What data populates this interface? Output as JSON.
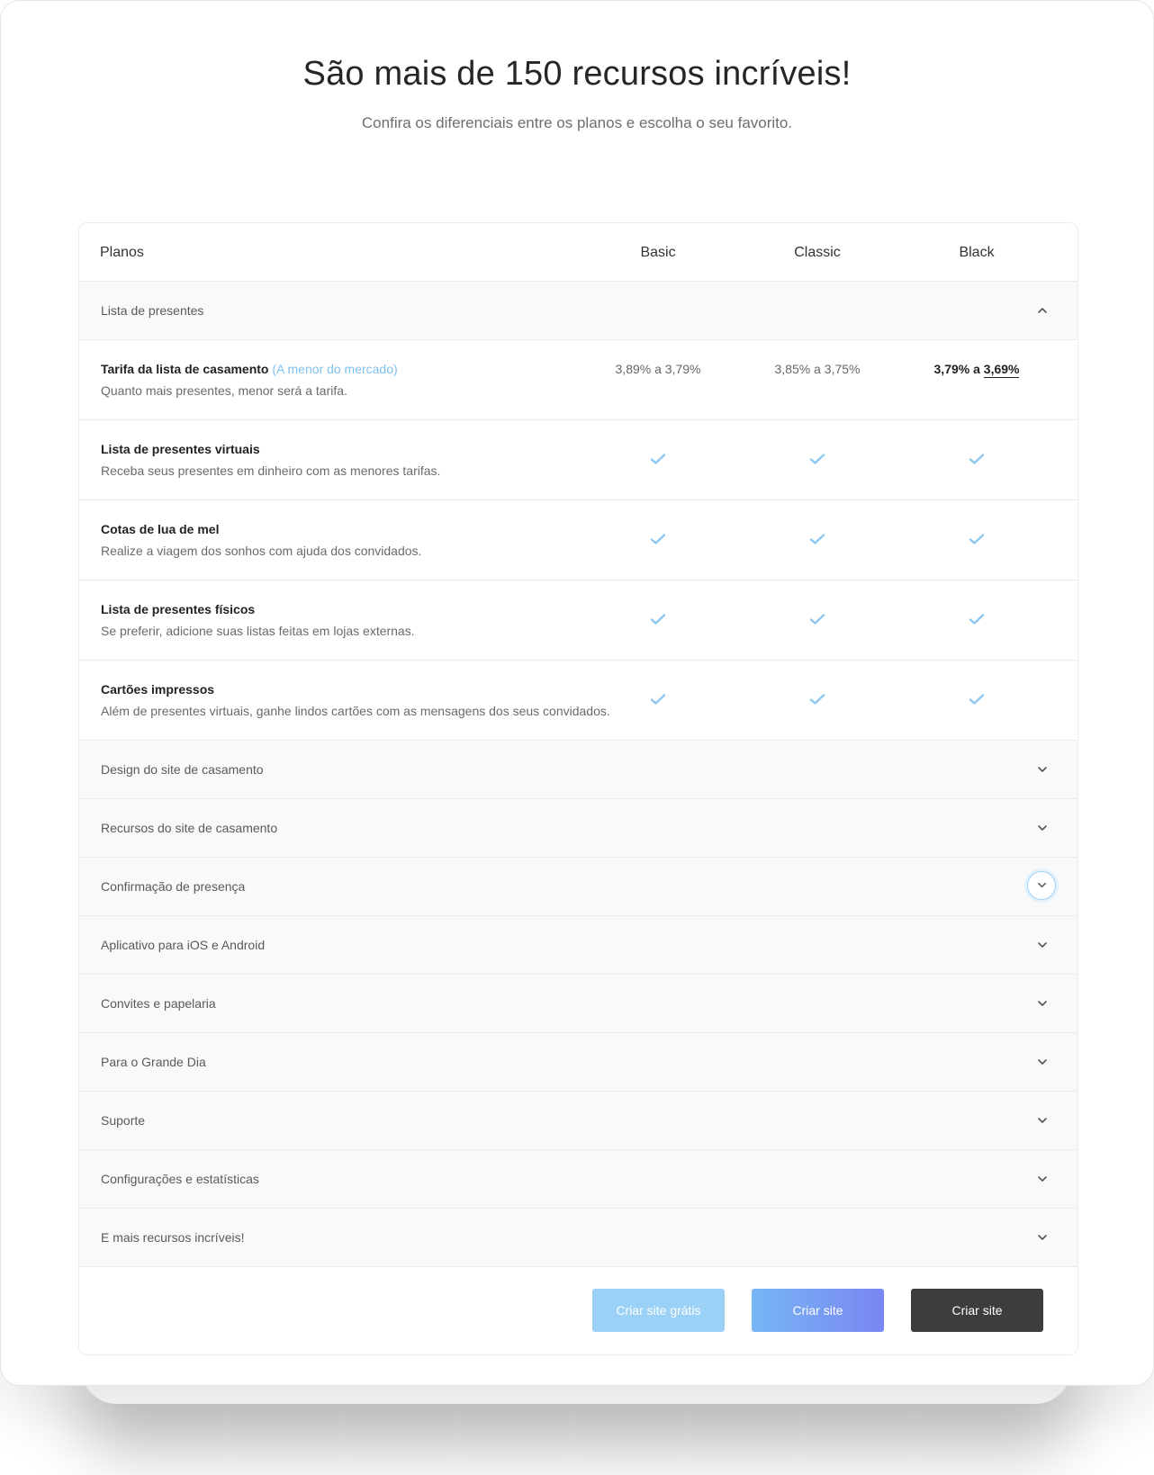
{
  "hero": {
    "title": "São mais de 150 recursos incríveis!",
    "subtitle": "Confira os diferenciais entre os planos e escolha o seu favorito."
  },
  "table": {
    "plans_label": "Planos",
    "columns": [
      "Basic",
      "Classic",
      "Black"
    ],
    "open_section": "Lista de presentes",
    "features": [
      {
        "title": "Tarifa da lista de casamento",
        "highlight": "(A menor do mercado)",
        "description": "Quanto mais presentes, menor será a tarifa.",
        "values": [
          "3,89% a 3,79%",
          "3,85% a 3,75%"
        ],
        "black_value_prefix": "3,79% a ",
        "black_value_underlined": "3,69%"
      },
      {
        "title": "Lista de presentes virtuais",
        "description": "Receba seus presentes em dinheiro com as menores tarifas."
      },
      {
        "title": "Cotas de lua de mel",
        "description": "Realize a viagem dos sonhos com ajuda dos convidados."
      },
      {
        "title": "Lista de presentes físicos",
        "description": "Se preferir, adicione suas listas feitas em lojas externas."
      },
      {
        "title": "Cartões impressos",
        "description": "Além de presentes virtuais, ganhe lindos cartões com as mensagens dos seus convidados."
      }
    ],
    "collapsed_sections": [
      "Design do site de casamento",
      "Recursos do site de casamento",
      "Confirmação de presença",
      "Aplicativo para iOS e Android",
      "Convites e papelaria",
      "Para o Grande Dia",
      "Suporte",
      "Configurações e estatísticas",
      "E mais recursos incríveis!"
    ]
  },
  "buttons": {
    "basic": "Criar site grátis",
    "classic": "Criar site",
    "black": "Criar site"
  },
  "icons": {
    "check": "check-icon",
    "chevron_up": "chevron-up-icon",
    "chevron_down": "chevron-down-icon"
  },
  "colors": {
    "accent_blue": "#7ec1ef",
    "check_blue": "#8cc8f0",
    "btn_basic": "#9bd0f7",
    "btn_classic_start": "#76b6f5",
    "btn_classic_end": "#7a86f2",
    "btn_black": "#3d3d3d"
  }
}
